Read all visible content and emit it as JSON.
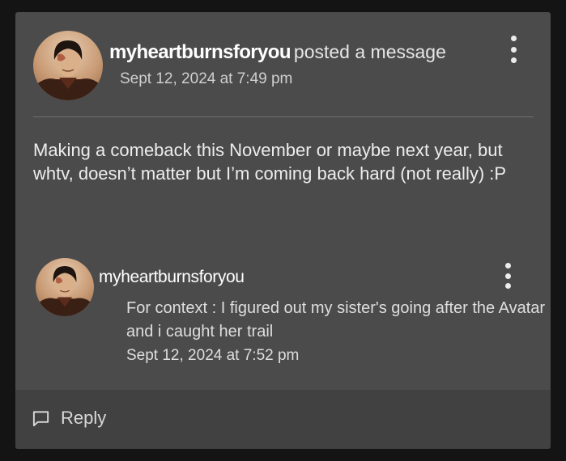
{
  "post": {
    "author": "myheartburnsforyou",
    "action": "posted a message",
    "timestamp": "Sept 12, 2024 at 7:49 pm",
    "body": "Making a comeback this November or maybe next year, but whtv, doesn’t matter but I’m coming back hard (not really) :P",
    "avatar_icon": "profile-avatar",
    "menu_icon": "kebab-menu-icon"
  },
  "comment": {
    "author": "myheartburnsforyou",
    "body": "For context : I figured out my sister's going after the Avatar and i caught her trail",
    "timestamp": "Sept 12, 2024 at 7:52 pm",
    "avatar_icon": "profile-avatar",
    "menu_icon": "kebab-menu-icon"
  },
  "footer": {
    "reply_label": "Reply",
    "reply_icon": "speech-bubble-icon"
  },
  "colors": {
    "page_background": "#141414",
    "card_background": "#4b4b4b",
    "footer_background": "#414141",
    "text_primary": "#ffffff",
    "text_secondary": "#cfcfcf"
  }
}
